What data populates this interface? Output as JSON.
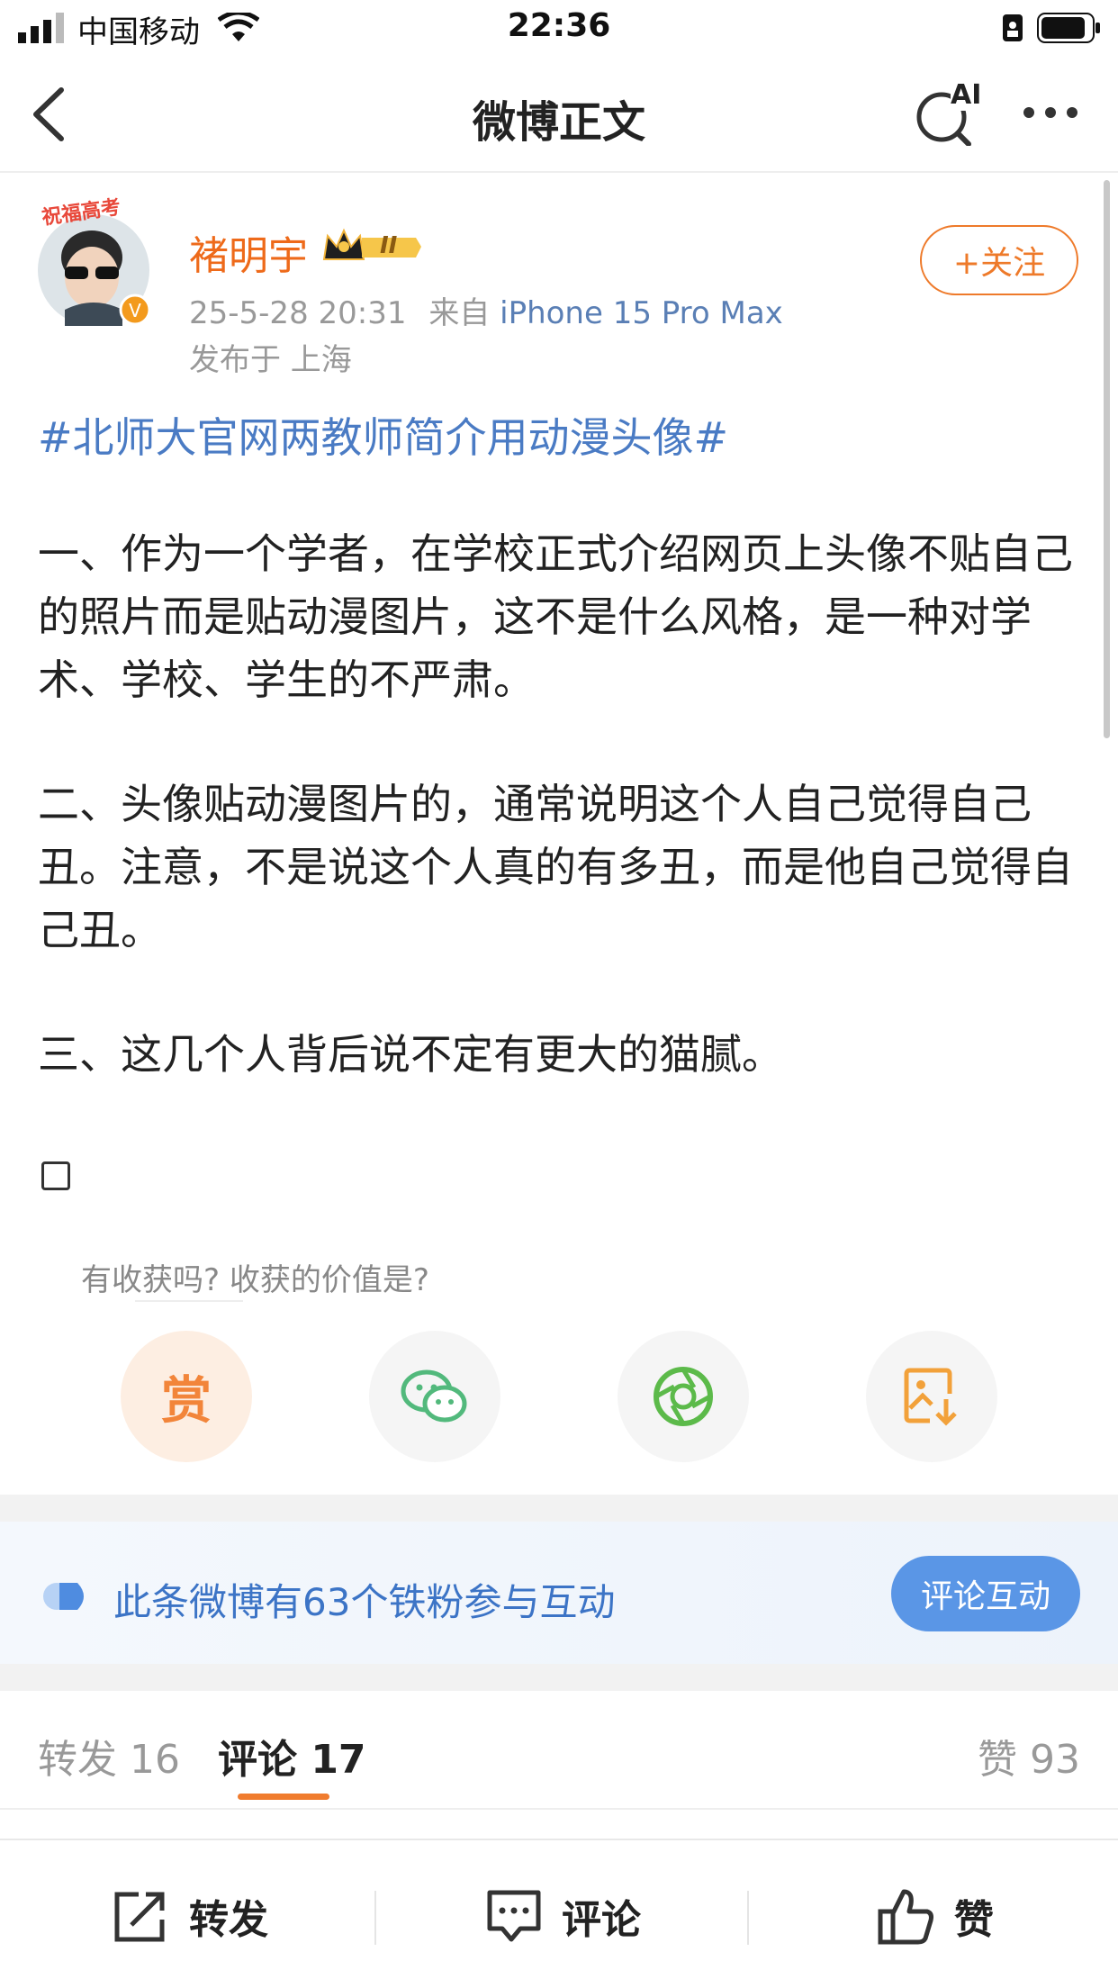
{
  "status_bar": {
    "carrier": "中国移动",
    "time": "22:36"
  },
  "nav": {
    "title": "微博正文",
    "ai_label": "AI"
  },
  "post": {
    "username": "褚明宇",
    "vip_level": "II",
    "avatar_banner": "祝福高考",
    "timestamp": "25-5-28 20:31",
    "source_prefix": "来自",
    "device": "iPhone 15 Pro Max",
    "location": "发布于 上海",
    "follow_label": "+关注",
    "hashtag": "#北师大官网两教师简介用动漫头像#",
    "paragraphs": [
      "一、作为一个学者，在学校正式介绍网页上头像不贴自己的照片而是贴动漫图片，这不是什么风格，是一种对学术、学校、学生的不严肃。",
      "二、头像贴动漫图片的，通常说明这个人自己觉得自己丑。注意，不是说这个人真的有多丑，而是他自己觉得自己丑。",
      "三、这几个人背后说不定有更大的猫腻。"
    ]
  },
  "reward": {
    "prompt": "有收获吗? 收获的价值是?",
    "reward_label": "赏",
    "actions": [
      "reward-icon",
      "wechat-icon",
      "moments-icon",
      "save-image-icon"
    ]
  },
  "fans": {
    "text": "此条微博有63个铁粉参与互动",
    "button": "评论互动"
  },
  "tabs": {
    "repost": "转发 16",
    "comment": "评论 17",
    "like": "赞 93"
  },
  "bottom_bar": {
    "repost": "转发",
    "comment": "评论",
    "like": "赞"
  },
  "colors": {
    "username": "#ee6a1a",
    "link": "#4a7bc4",
    "accent": "#f07c2e",
    "fans_button": "#5a96e6"
  }
}
